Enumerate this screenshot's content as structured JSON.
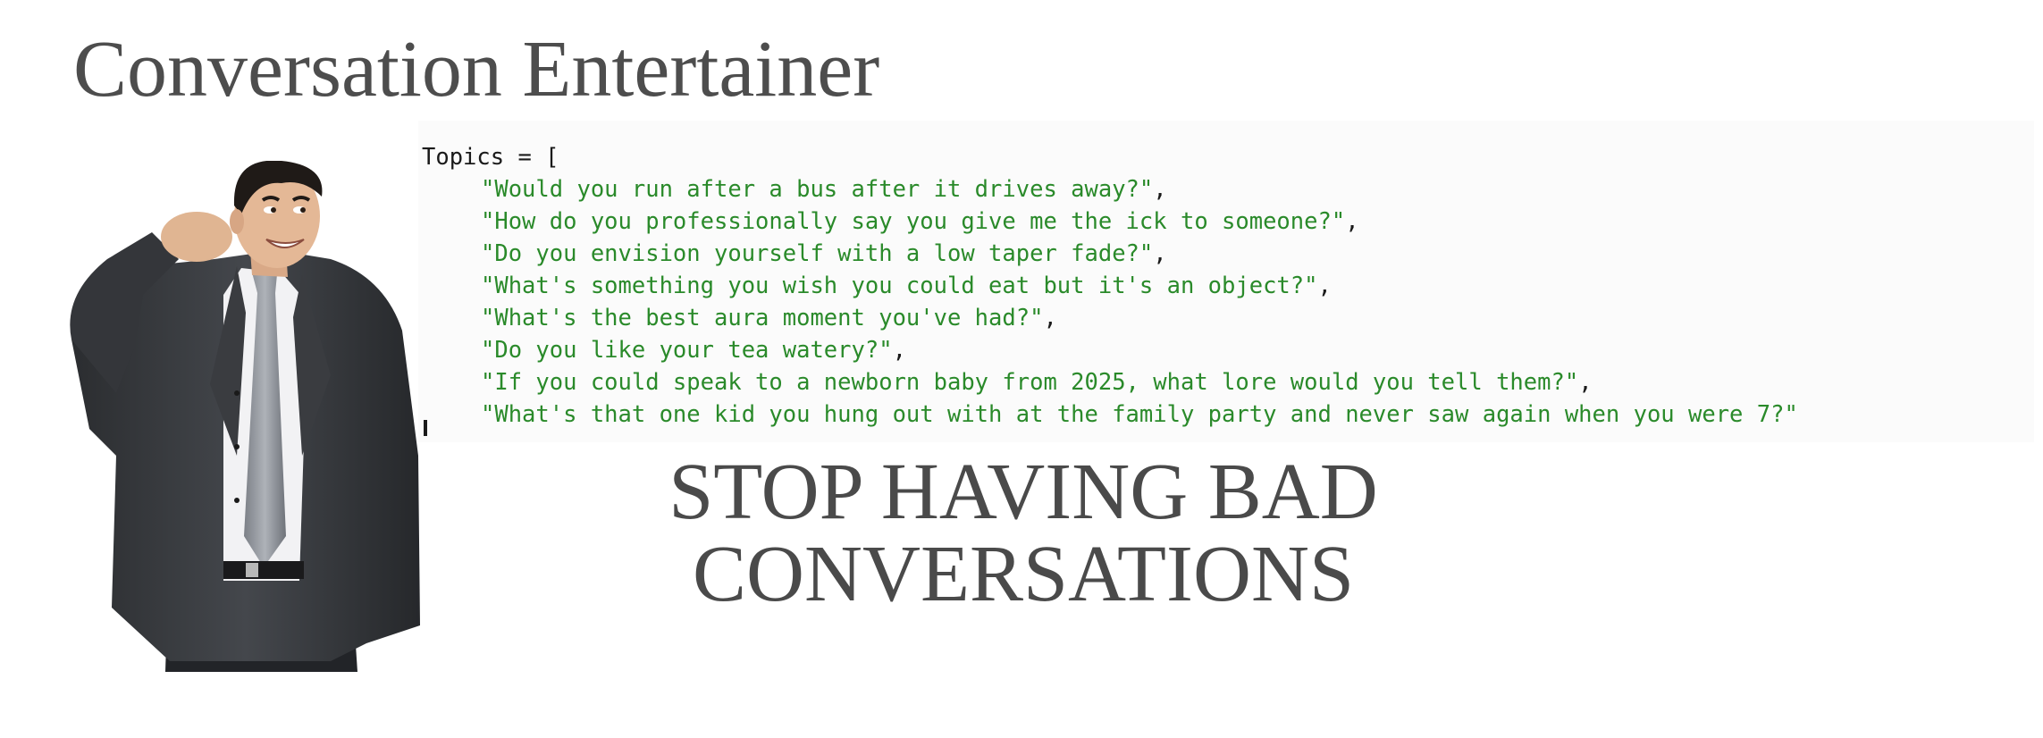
{
  "page": {
    "title": "Conversation Entertainer",
    "slogan_line1": "STOP HAVING BAD",
    "slogan_line2": "CONVERSATIONS"
  },
  "code": {
    "header": "Topics = [",
    "topics": [
      "\"Would you run after a bus after it drives away?\"",
      "\"How do you professionally say you give me the ick to someone?\"",
      "\"Do you envision yourself with a low taper fade?\"",
      "\"What's something you wish you could eat but it's an object?\"",
      "\"What's the best aura moment you've had?\"",
      "\"Do you like your tea watery?\"",
      "\"If you could speak to a newborn baby from 2025, what lore would you tell them?\"",
      "\"What's that one kid you hung out with at the family party and never saw again when you were 7?\""
    ],
    "separator": ",",
    "string_color": "#2a8a2a"
  },
  "colors": {
    "heading": "#4d4d4d",
    "code_bg": "#fbfbfb"
  }
}
